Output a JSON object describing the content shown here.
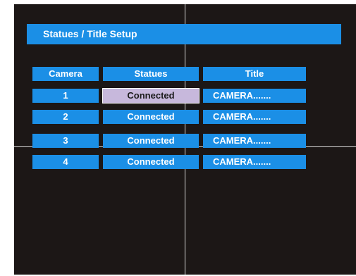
{
  "window": {
    "title": "Statues / Title Setup"
  },
  "table": {
    "headers": {
      "camera": "Camera",
      "statues": "Statues",
      "title": "Title"
    },
    "rows": [
      {
        "camera": "1",
        "statues": "Connected",
        "title": "CAMERA......."
      },
      {
        "camera": "2",
        "statues": "Connected",
        "title": "CAMERA......."
      },
      {
        "camera": "3",
        "statues": "Connected",
        "title": "CAMERA......."
      },
      {
        "camera": "4",
        "statues": "Connected",
        "title": "CAMERA......."
      }
    ],
    "selected_cell": "row 1 statues"
  },
  "colors": {
    "screen_background": "#1c1716",
    "accent_blue": "#1b8fe6",
    "selection": "#c7b8dc",
    "crosshair": "#d8d8d8"
  }
}
